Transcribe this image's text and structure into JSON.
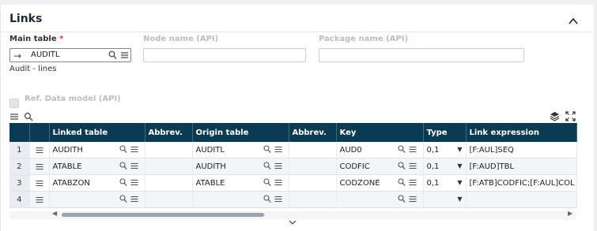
{
  "section": {
    "title": "Links"
  },
  "form": {
    "main_table_label": "Main table",
    "required_mark": "*",
    "main_table_value": "AUDITL",
    "main_table_description": "Audit - lines",
    "node_name_label": "Node name (API)",
    "node_name_value": "",
    "package_name_label": "Package name (API)",
    "package_name_value": "",
    "ref_model_label": "Ref. Data model (API)"
  },
  "grid": {
    "columns": [
      "Linked table",
      "Abbrev.",
      "Origin table",
      "Abbrev.",
      "Key",
      "Type",
      "Link expression"
    ],
    "rows": [
      {
        "num": "1",
        "linked_table": "AUDITH",
        "abbrev1": "",
        "origin_table": "AUDITL",
        "abbrev2": "",
        "key": "AUD0",
        "type": "0,1",
        "link_expression": "[F:AUL]SEQ"
      },
      {
        "num": "2",
        "linked_table": "ATABLE",
        "abbrev1": "",
        "origin_table": "AUDITH",
        "abbrev2": "",
        "key": "CODFIC",
        "type": "0,1",
        "link_expression": "[F:AUD]TBL"
      },
      {
        "num": "3",
        "linked_table": "ATABZON",
        "abbrev1": "",
        "origin_table": "ATABLE",
        "abbrev2": "",
        "key": "CODZONE",
        "type": "0,1",
        "link_expression": "[F:ATB]CODFIC;[F:AUL]COL"
      },
      {
        "num": "4",
        "linked_table": "",
        "abbrev1": "",
        "origin_table": "",
        "abbrev2": "",
        "key": "",
        "type": "",
        "link_expression": ""
      }
    ]
  }
}
